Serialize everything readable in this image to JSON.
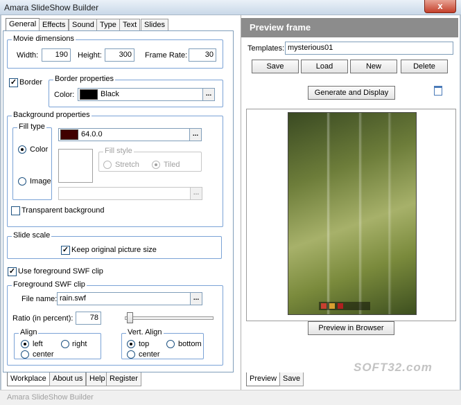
{
  "window": {
    "title": "Amara SlideShow Builder",
    "close_label": "x"
  },
  "top_tabs": [
    "General",
    "Effects",
    "Sound",
    "Type",
    "Text",
    "Slides"
  ],
  "movie_dimensions": {
    "label": "Movie dimensions",
    "width_label": "Width:",
    "width_value": "190",
    "height_label": "Height:",
    "height_value": "300",
    "framerate_label": "Frame Rate:",
    "framerate_value": "30"
  },
  "border": {
    "checkbox_label": "Border",
    "checked": true,
    "group_label": "Border properties",
    "color_label": "Color:",
    "color_value": "Black",
    "color_swatch": "#000000",
    "browse": "..."
  },
  "background": {
    "group_label": "Background properties",
    "fill_type_label": "Fill type",
    "color_option": "Color",
    "image_option": "Image",
    "color_value": "64.0.0",
    "color_swatch": "#400000",
    "browse": "...",
    "fill_style_label": "Fill style",
    "stretch_option": "Stretch",
    "tiled_option": "Tiled",
    "image_path": "",
    "transparent_label": "Transparent background"
  },
  "slide_scale": {
    "group_label": "Slide scale",
    "keep_size_label": "Keep original picture size",
    "checked": true
  },
  "foreground": {
    "use_label": "Use foreground SWF clip",
    "checked": true,
    "group_label": "Foreground SWF clip",
    "file_label": "File name:",
    "file_value": "rain.swf",
    "browse": "...",
    "ratio_label": "Ratio (in percent):",
    "ratio_value": "78",
    "align_label": "Align",
    "align_left": "left",
    "align_right": "right",
    "align_center": "center",
    "valign_label": "Vert. Align",
    "valign_top": "top",
    "valign_bottom": "bottom",
    "valign_center": "center"
  },
  "bottom_tabs_left": [
    "Workplace",
    "About us",
    "Help",
    "Register"
  ],
  "preview": {
    "header": "Preview frame",
    "templates_label": "Templates:",
    "templates_value": "mysterious01",
    "save": "Save",
    "load": "Load",
    "new": "New",
    "delete": "Delete",
    "generate": "Generate and Display",
    "preview_browser": "Preview in Browser"
  },
  "bottom_tabs_right": [
    "Preview",
    "Save"
  ],
  "status_text": "Amara SlideShow Builder",
  "watermark": "SOFT32.com"
}
